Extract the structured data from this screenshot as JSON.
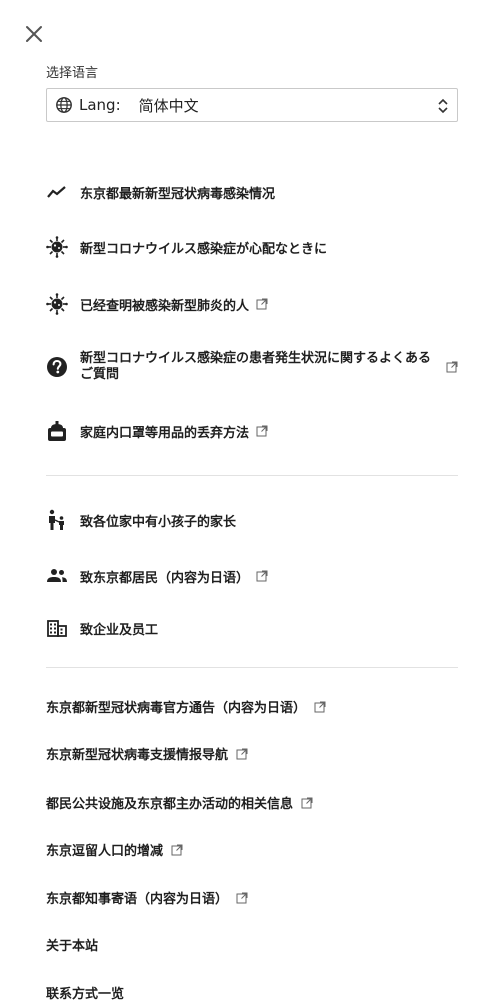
{
  "close_icon": "close-icon",
  "language": {
    "label": "选择语言",
    "prefix": "Lang:",
    "selected": "简体中文"
  },
  "section1": [
    {
      "label": "东京都最新新型冠状病毒感染情况",
      "icon": "trend-icon",
      "external": false
    },
    {
      "label": "新型コロナウイルス感染症が心配なときに",
      "icon": "virus-icon",
      "external": false
    },
    {
      "label": "已经查明被感染新型肺炎的人",
      "icon": "virus-icon",
      "external": true
    },
    {
      "label": "新型コロナウイルス感染症の患者発生状況に関するよくあるご質問",
      "icon": "question-icon",
      "external": true
    },
    {
      "label": "家庭内口罩等用品的丢弃方法",
      "icon": "trash-bin-icon",
      "external": true
    }
  ],
  "section2": [
    {
      "label": "致各位家中有小孩子的家长",
      "icon": "family-icon",
      "external": false
    },
    {
      "label": "致东京都居民（内容为日语）",
      "icon": "people-icon",
      "external": true
    },
    {
      "label": "致企业及员工",
      "icon": "building-icon",
      "external": false
    }
  ],
  "section3": [
    {
      "label": "东京都新型冠状病毒官方通告（内容为日语）",
      "external": true
    },
    {
      "label": "东京新型冠状病毒支援情报导航",
      "external": true
    },
    {
      "label": "都民公共设施及东京都主办活动的相关信息",
      "external": true
    },
    {
      "label": "东京逗留人口的增减",
      "external": true
    },
    {
      "label": "东京都知事寄语（内容为日语）",
      "external": true
    },
    {
      "label": "关于本站",
      "external": false
    },
    {
      "label": "联系方式一览",
      "external": false
    }
  ]
}
